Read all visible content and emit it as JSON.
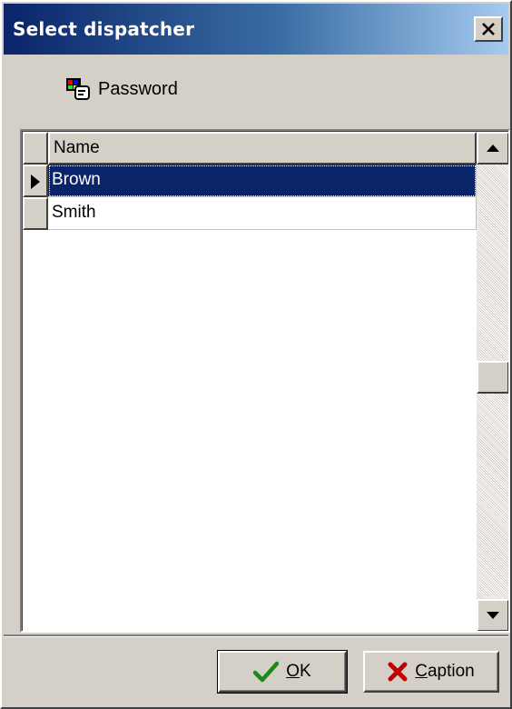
{
  "window": {
    "title": "Select dispatcher",
    "close_icon": "close-icon"
  },
  "toolbar": {
    "password_label": "Password",
    "password_icon": "password-card-icon"
  },
  "grid": {
    "header": "Name",
    "rows": [
      {
        "name": "Brown",
        "selected": true
      },
      {
        "name": "Smith",
        "selected": false
      }
    ],
    "selection_color": "#0a246a"
  },
  "buttons": {
    "ok": {
      "accel": "O",
      "rest": "K",
      "icon": "checkmark-icon"
    },
    "caption": {
      "accel": "C",
      "rest": "aption",
      "icon": "x-icon"
    }
  },
  "colors": {
    "title_gradient_start": "#0a246a",
    "title_gradient_end": "#a6caf0",
    "face": "#d4d0c8"
  }
}
